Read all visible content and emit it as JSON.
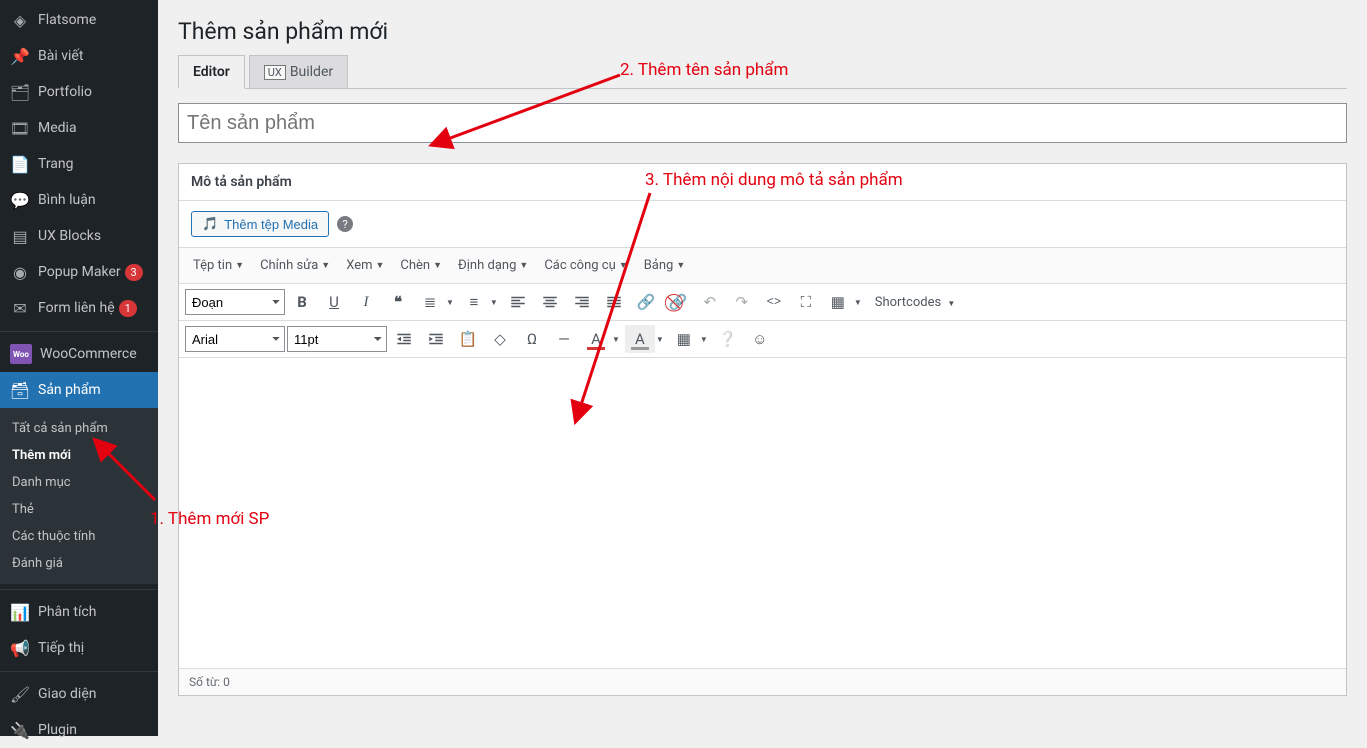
{
  "sidebar": {
    "items": [
      {
        "icon": "◈",
        "label": "Flatsome"
      },
      {
        "icon": "📌",
        "label": "Bài viết"
      },
      {
        "icon": "🗂",
        "label": "Portfolio"
      },
      {
        "icon": "🎞",
        "label": "Media"
      },
      {
        "icon": "📄",
        "label": "Trang"
      },
      {
        "icon": "💬",
        "label": "Bình luận"
      },
      {
        "icon": "▤",
        "label": "UX Blocks"
      },
      {
        "icon": "◉",
        "label": "Popup Maker",
        "badge": "3"
      },
      {
        "icon": "✉",
        "label": "Form liên hệ",
        "badge": "1"
      },
      {
        "icon": "woo",
        "label": "WooCommerce"
      },
      {
        "icon": "🗃",
        "label": "Sản phẩm",
        "current": true
      },
      {
        "icon": "📊",
        "label": "Phân tích"
      },
      {
        "icon": "📢",
        "label": "Tiếp thị"
      },
      {
        "icon": "🖌",
        "label": "Giao diện"
      },
      {
        "icon": "🔌",
        "label": "Plugin"
      }
    ],
    "submenu": [
      {
        "label": "Tất cả sản phẩm"
      },
      {
        "label": "Thêm mới",
        "current": true
      },
      {
        "label": "Danh mục"
      },
      {
        "label": "Thẻ"
      },
      {
        "label": "Các thuộc tính"
      },
      {
        "label": "Đánh giá"
      }
    ]
  },
  "page": {
    "title": "Thêm sản phẩm mới",
    "tabs": {
      "editor": "Editor",
      "ux": "UX",
      "builder": "Builder"
    },
    "title_placeholder": "Tên sản phẩm",
    "desc_header": "Mô tả sản phẩm",
    "add_media": "Thêm tệp Media",
    "menubar": [
      "Tệp tin",
      "Chỉnh sửa",
      "Xem",
      "Chèn",
      "Định dạng",
      "Các công cụ",
      "Bảng"
    ],
    "format_select": "Đoạn",
    "font_select": "Arial",
    "size_select": "11pt",
    "shortcodes": "Shortcodes",
    "wordcount": "Số từ: 0"
  },
  "annotations": {
    "a1": "1. Thêm mới SP",
    "a2": "2. Thêm tên sản phẩm",
    "a3": "3. Thêm nội dung mô tả sản phẩm"
  }
}
